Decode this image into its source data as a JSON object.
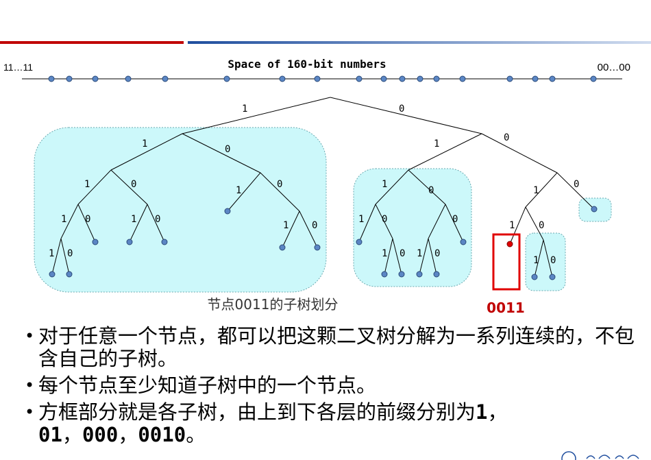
{
  "header": {
    "title": "Space of 160-bit numbers",
    "left_label": "11…11",
    "right_label": "00…00"
  },
  "tree": {
    "edge_labels": {
      "root_left": "1",
      "root_right": "0",
      "l_left": "1",
      "l_right": "0",
      "ll_left": "1",
      "ll_right": "0",
      "lll_left": "1",
      "lll_right": "0",
      "llll_left": "1",
      "llll_right": "0",
      "llr_left": "1",
      "llr_right": "0",
      "lr_left": "1",
      "lr_right": "0",
      "lrr_left": "1",
      "lrr_right": "0",
      "r_left": "1",
      "r_right": "0",
      "rl_left": "1",
      "rl_right": "0",
      "rll_left": "1",
      "rll_right": "0",
      "rlll_left": "1",
      "rlll_right": "0",
      "rllr_left": "1",
      "rllr_right": "0",
      "rlr_left": "1",
      "rlr_right": "0",
      "rr_left": "1",
      "rr_right": "0",
      "rrl_left": "1",
      "rrl_right": "0",
      "rrlr_left": "1",
      "rrlr_right": "0"
    },
    "caption": "节点0011的子树划分",
    "highlight_label": "0011"
  },
  "bullets": [
    {
      "text": "对于任意一个节点，都可以把这颗二叉树分解为一系列连续的，不包含自己的子树。"
    },
    {
      "text": "每个节点至少知道子树中的一个节点。"
    },
    {
      "text_before": "方框部分就是各子树，由上到下各层的前缀分别为",
      "t1": "1",
      "s1": "，",
      "t2": "01",
      "s2": "，",
      "t3": "000",
      "s3": "，",
      "t4": "0010",
      "text_after": "。"
    }
  ],
  "colors": {
    "accent_red": "#c00000",
    "accent_blue": "#1f4e9e",
    "subtree_fill": "#ccf8fa",
    "node_fill": "#5b86c4",
    "highlight_red": "#e00000"
  }
}
